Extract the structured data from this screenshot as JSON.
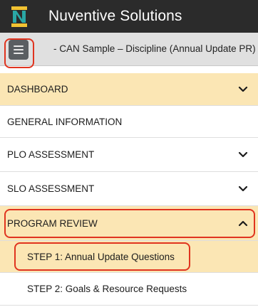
{
  "app": {
    "title": "Nuventive Solutions"
  },
  "subbar": {
    "breadcrumb": "- CAN Sample – Discipline (Annual Update PR)"
  },
  "nav": {
    "items": [
      {
        "label": "DASHBOARD",
        "chevron": "down"
      },
      {
        "label": "GENERAL INFORMATION",
        "chevron": "none"
      },
      {
        "label": "PLO ASSESSMENT",
        "chevron": "down"
      },
      {
        "label": "SLO ASSESSMENT",
        "chevron": "down"
      },
      {
        "label": "PROGRAM REVIEW",
        "chevron": "up"
      }
    ],
    "subitems": [
      {
        "label": "STEP 1: Annual Update Questions"
      },
      {
        "label": "STEP 2: Goals & Resource Requests"
      }
    ]
  },
  "colors": {
    "topbar": "#2b2b2b",
    "active_bg": "#fbe6b4",
    "highlight": "#e0341f",
    "logo_gold": "#f2c232",
    "logo_teal": "#2aa7a5"
  },
  "icons": {
    "logo": "nuventive-logo",
    "menu": "hamburger-menu-icon",
    "chevron": "chevron-icon"
  }
}
